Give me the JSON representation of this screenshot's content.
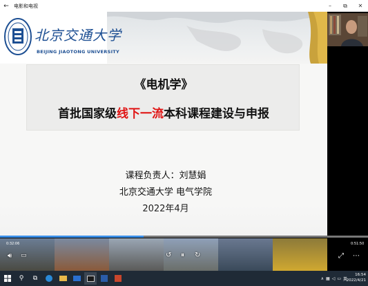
{
  "window": {
    "title": "电影和电视",
    "back_glyph": "←",
    "minimize_glyph": "–",
    "maximize_glyph": "⧉",
    "close_glyph": "✕"
  },
  "slide": {
    "university_cn": "北京交通大学",
    "university_en": "BEIJING JIAOTONG UNIVERSITY",
    "course_title": "《电机学》",
    "subtitle_pre": "首批国家级",
    "subtitle_highlight": "线下一流",
    "subtitle_post": "本科课程建设与申报",
    "lead_line": "课程负责人：刘慧娟",
    "org_line": "北京交通大学  电气学院",
    "date_line": "2022年4月"
  },
  "player": {
    "time_elapsed": "0:32:06",
    "time_remaining": "0:51:50",
    "progress_fraction": 0.39
  },
  "taskbar": {
    "time": "16:54",
    "date": "2022/4/21",
    "ime": "英"
  },
  "colors": {
    "brand_blue": "#1d4f93",
    "highlight_red": "#e01414",
    "accent": "#3a8ee6"
  }
}
